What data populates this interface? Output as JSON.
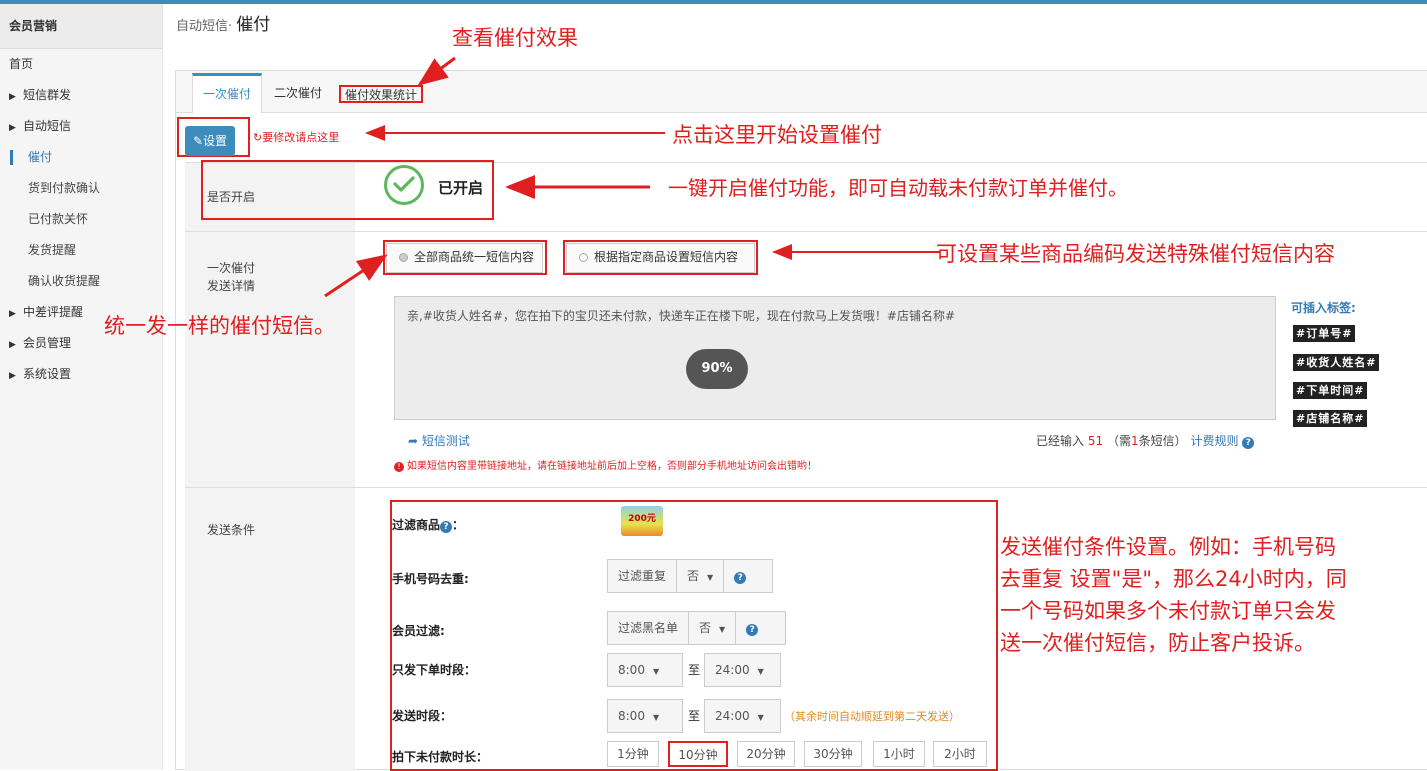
{
  "sidebar": {
    "header": "会员营销",
    "items": [
      {
        "label": "首页",
        "level": 0,
        "arrow": ""
      },
      {
        "label": "短信群发",
        "level": 0,
        "arrow": "▶"
      },
      {
        "label": "自动短信",
        "level": 0,
        "arrow": "▶"
      },
      {
        "label": "催付",
        "level": 1,
        "arrow": "",
        "active": true
      },
      {
        "label": "货到付款确认",
        "level": 1,
        "arrow": ""
      },
      {
        "label": "已付款关怀",
        "level": 1,
        "arrow": ""
      },
      {
        "label": "发货提醒",
        "level": 1,
        "arrow": ""
      },
      {
        "label": "确认收货提醒",
        "level": 1,
        "arrow": ""
      },
      {
        "label": "中差评提醒",
        "level": 0,
        "arrow": "▶"
      },
      {
        "label": "会员管理",
        "level": 0,
        "arrow": "▶"
      },
      {
        "label": "系统设置",
        "level": 0,
        "arrow": "▶"
      }
    ]
  },
  "breadcrumb": {
    "parent": "自动短信·",
    "current": "催付"
  },
  "tabs": {
    "first": "一次催付",
    "second": "二次催付",
    "third": "催付效果统计"
  },
  "toolbar": {
    "set_button": "设置",
    "set_note": "要修改请点这里"
  },
  "enable_row": {
    "label": "是否开启",
    "status": "已开启"
  },
  "detail_row": {
    "label_line1": "一次催付",
    "label_line2": "发送详情",
    "option_all": "全部商品统一短信内容",
    "option_specific": "根据指定商品设置短信内容",
    "message": "亲,#收货人姓名#，您在拍下的宝贝还未付款，快递车正在楼下呢，现在付款马上发货哦！#店铺名称#",
    "progress": "90%",
    "tags_title": "可插入标签:",
    "tags": [
      "#订单号#",
      "#收货人姓名#",
      "#下单时间#",
      "#店铺名称#"
    ],
    "sms_test": "短信测试",
    "count_prefix": "已经输入",
    "count_value": "51",
    "count_mid": "（需",
    "count_sms": "1",
    "count_suffix": "条短信）",
    "billing_rule": "计费规则",
    "warning": "如果短信内容里带链接地址，请在链接地址前后加上空格，否则部分手机地址访问会出错哟！"
  },
  "conditions": {
    "label": "发送条件",
    "filter_goods": "过滤商品",
    "promo_text": "200元",
    "phone_dedup": "手机号码去重:",
    "phone_dedup_opt": "过滤重复",
    "phone_dedup_val": "否",
    "member_filter": "会员过滤:",
    "member_filter_opt": "过滤黑名单",
    "member_filter_val": "否",
    "order_period": "只发下单时段：",
    "order_from": "8:00",
    "to": "至",
    "order_to": "24:00",
    "send_period": "发送时段：",
    "send_from": "8:00",
    "send_to": "24:00",
    "send_note": "（其余时间自动顺延到第二天发送）",
    "unpaid_duration": "拍下未付款时长：",
    "durations": [
      "1分钟",
      "10分钟",
      "20分钟",
      "30分钟",
      "1小时",
      "2小时"
    ],
    "selected_duration": "10分钟"
  },
  "annotations": {
    "view_effect": "查看催付效果",
    "click_setup": "点击这里开始设置催付",
    "one_click": "一键开启催付功能，即可自动载未付款订单并催付。",
    "special_sms": "可设置某些商品编码发送特殊催付短信内容",
    "same_sms": "统一发一样的催付短信。",
    "cond_line1": "发送催付条件设置。例如：手机号码",
    "cond_line2": "去重复 设置\"是\"，那么24小时内，同",
    "cond_line3": "一个号码如果多个未付款订单只会发",
    "cond_line4": "送一次催付短信，防止客户投诉。"
  },
  "colors": {
    "accent": "#3c8dbc",
    "annotation": "#e02020",
    "enabled": "#5cb85c"
  }
}
